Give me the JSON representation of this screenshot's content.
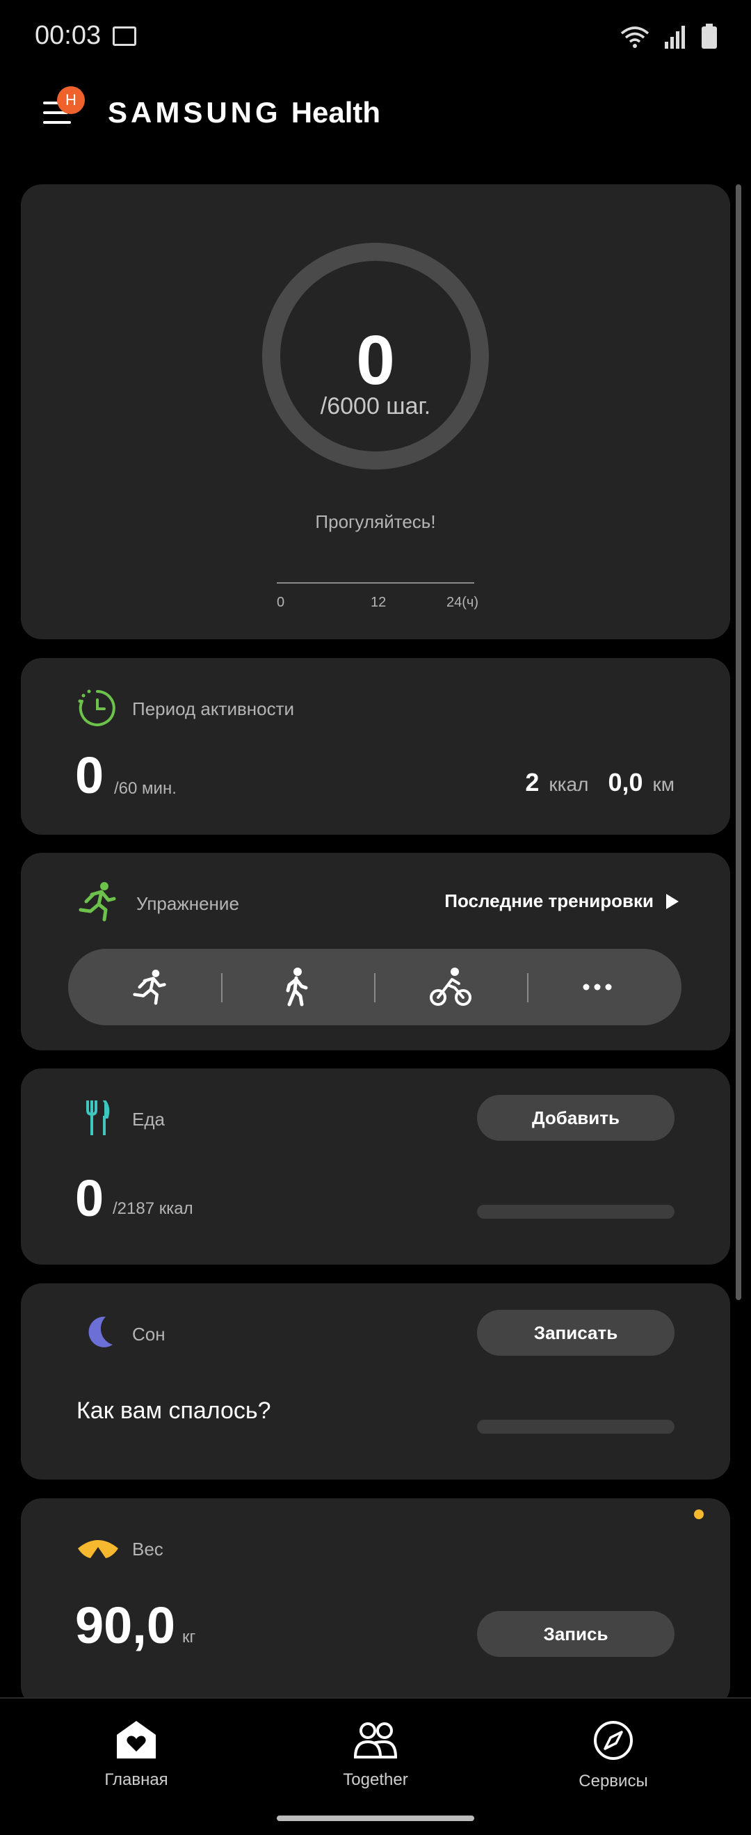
{
  "status": {
    "time": "00:03"
  },
  "header": {
    "badge": "H",
    "brand_samsung": "SAMSUNG",
    "brand_health": "Health"
  },
  "steps": {
    "value": "0",
    "goal": "/6000 шаг.",
    "message": "Прогуляйтесь!",
    "progress": 0,
    "axis": [
      "0",
      "12",
      "24(ч)"
    ]
  },
  "activity": {
    "title": "Период активности",
    "value": "0",
    "goal": "/60 мин.",
    "kcal_value": "2",
    "kcal_unit": "ккал",
    "km_value": "0,0",
    "km_unit": "км"
  },
  "exercise": {
    "title": "Упражнение",
    "recent_link": "Последние тренировки",
    "icons": [
      "running-icon",
      "walking-icon",
      "cycling-icon",
      "more-icon"
    ]
  },
  "food": {
    "title": "Еда",
    "add_button": "Добавить",
    "value": "0",
    "goal": "/2187 ккал",
    "progress": 0
  },
  "sleep": {
    "title": "Сон",
    "record_button": "Записать",
    "question": "Как вам спалось?"
  },
  "weight": {
    "title": "Вес",
    "value": "90,0",
    "unit": "кг",
    "record_button": "Запись"
  },
  "nav": {
    "home": "Главная",
    "together": "Together",
    "services": "Сервисы"
  },
  "colors": {
    "accent_green": "#6cc24a",
    "food_teal": "#3fc6c0",
    "sleep_purple": "#6b6fd6",
    "weight_yellow": "#f5b82e",
    "badge_orange": "#f0622b"
  }
}
